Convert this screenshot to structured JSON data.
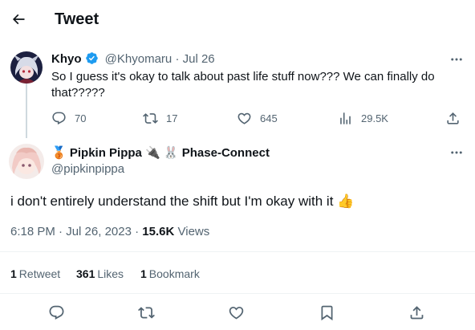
{
  "header": {
    "title": "Tweet",
    "back_icon": "arrow-left-icon"
  },
  "parent_tweet": {
    "display_name": "Khyo",
    "handle": "@Khyomaru",
    "separator": "·",
    "date": "Jul 26",
    "text": "So I guess it's okay to talk about past life stuff now??? We can finally do that?????",
    "actions": {
      "replies": "70",
      "retweets": "17",
      "likes": "645",
      "views": "29.5K"
    }
  },
  "main_tweet": {
    "name_emoji_prefix": "🥉",
    "display_name": "Pipkin Pippa",
    "name_emoji_suffix": "🔌 🐰",
    "affiliation": "Phase-Connect",
    "handle": "@pipkinpippa",
    "text": "i don't entirely understand the shift but I'm okay with it",
    "text_emoji": "👍",
    "time": "6:18 PM",
    "date_sep": "·",
    "date": "Jul 26, 2023",
    "views_sep": "·",
    "views_count": "15.6K",
    "views_label": "Views"
  },
  "stats": {
    "retweets_count": "1",
    "retweets_label": "Retweet",
    "likes_count": "361",
    "likes_label": "Likes",
    "bookmarks_count": "1",
    "bookmarks_label": "Bookmark"
  },
  "colors": {
    "verified": "#1d9bf0",
    "text": "#0f1419",
    "muted": "#536471",
    "divider": "#eff3f4",
    "emoji_thumb": "#f7b93f"
  }
}
